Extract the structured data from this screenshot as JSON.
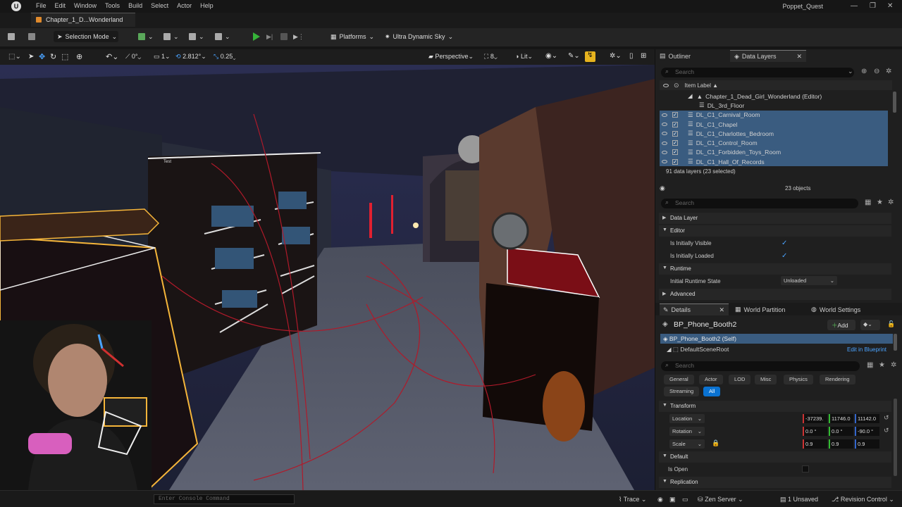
{
  "menu": {
    "items": [
      "File",
      "Edit",
      "Window",
      "Tools",
      "Build",
      "Select",
      "Actor",
      "Help"
    ],
    "project": "Poppet_Quest"
  },
  "level_tab": {
    "label": "Chapter_1_D...Wonderland"
  },
  "toolbar": {
    "selection_mode": "Selection Mode",
    "platforms": "Platforms",
    "sky": "Ultra Dynamic Sky"
  },
  "viewport_bar": {
    "rotate_snap": "0°",
    "scale_grid": "1",
    "camera_speed": "2.812°",
    "snap_value": "0.25",
    "perspective": "Perspective",
    "fov": "8",
    "lit": "Lit"
  },
  "viewport": {
    "tag": "Test"
  },
  "outliner": {
    "tab_outliner": "Outliner",
    "tab_data_layers": "Data Layers",
    "search_placeholder": "Search",
    "column_label": "Item Label ▲",
    "root": "Chapter_1_Dead_Girl_Wonderland (Editor)",
    "rows": [
      {
        "label": "DL_3rd_Floor",
        "selected": false
      },
      {
        "label": "DL_C1_Carnival_Room",
        "selected": true
      },
      {
        "label": "DL_C1_Chapel",
        "selected": true
      },
      {
        "label": "DL_C1_Charlottes_Bedroom",
        "selected": true
      },
      {
        "label": "DL_C1_Control_Room",
        "selected": true
      },
      {
        "label": "DL_C1_Forbidden_Toys_Room",
        "selected": true
      },
      {
        "label": "DL_C1_Hall_Of_Records",
        "selected": true
      }
    ],
    "footer": "91 data layers (23 selected)"
  },
  "layer_details": {
    "objects": "23 objects",
    "search_placeholder": "Search",
    "section_data_layer": "Data Layer",
    "section_editor": "Editor",
    "initially_visible": "Is Initially Visible",
    "initially_loaded": "Is Initially Loaded",
    "section_runtime": "Runtime",
    "runtime_state_label": "Initial Runtime State",
    "runtime_state_value": "Unloaded",
    "section_advanced": "Advanced"
  },
  "details": {
    "tab_details": "Details",
    "tab_world_partition": "World Partition",
    "tab_world_settings": "World Settings",
    "actor_name": "BP_Phone_Booth2",
    "add_label": "Add",
    "self_row": "BP_Phone_Booth2 (Self)",
    "root_component": "DefaultSceneRoot",
    "edit_blueprint": "Edit in Blueprint",
    "search_placeholder": "Search",
    "filters": [
      "General",
      "Actor",
      "LOD",
      "Misc",
      "Physics",
      "Rendering",
      "Streaming",
      "All"
    ],
    "active_filter": "All",
    "section_transform": "Transform",
    "location_label": "Location",
    "location": [
      "-37239.",
      "11746.0",
      "11142.0"
    ],
    "rotation_label": "Rotation",
    "rotation": [
      "0.0 °",
      "0.0 °",
      "-90.0 °"
    ],
    "scale_label": "Scale",
    "scale": [
      "0.9",
      "0.9",
      "0.9"
    ],
    "section_default": "Default",
    "is_open": "Is Open",
    "section_replication": "Replication"
  },
  "console": {
    "placeholder": "Enter Console Command"
  },
  "statusbar": {
    "trace": "Trace",
    "zen": "Zen Server",
    "unsaved": "1 Unsaved",
    "revision": "Revision Control"
  },
  "colors": {
    "accent": "#0a72d1",
    "selection": "#3a5c80",
    "play": "#36b339",
    "highlight": "#f5b53a"
  }
}
